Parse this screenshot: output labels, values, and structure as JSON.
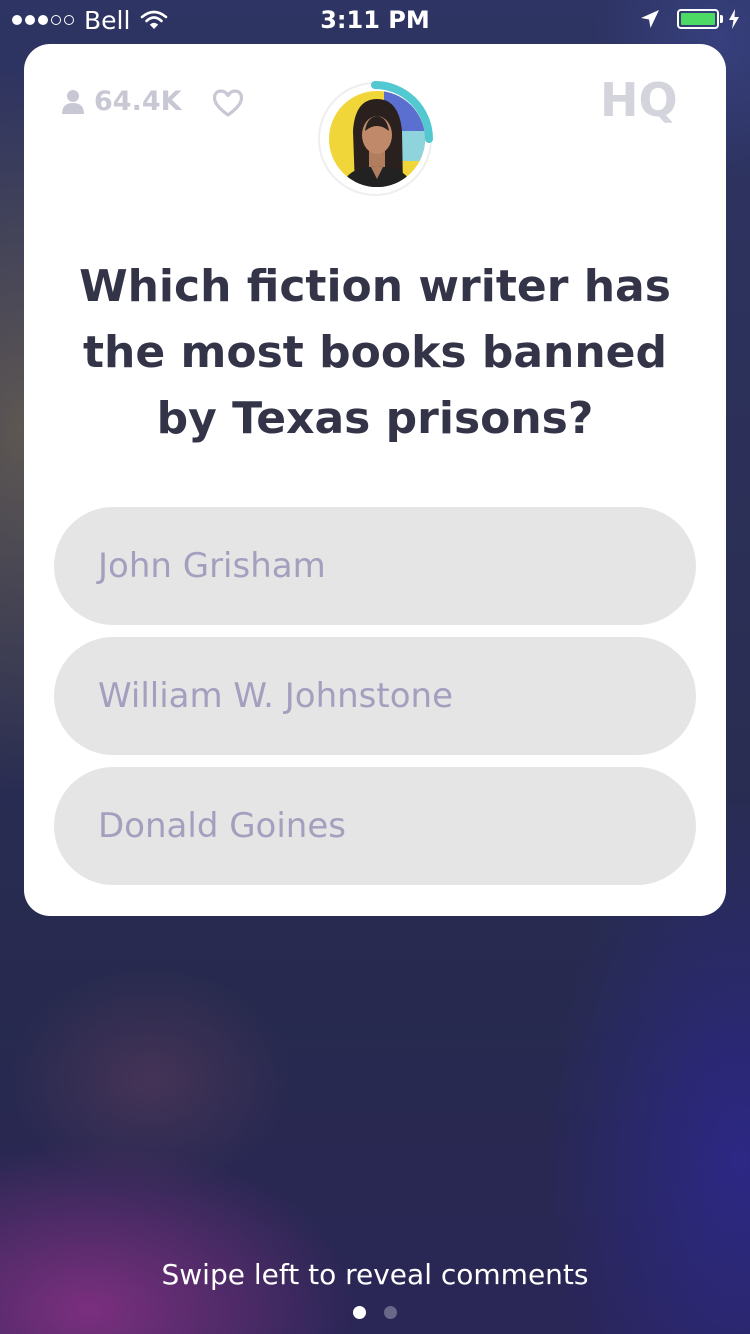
{
  "status_bar": {
    "carrier": "Bell",
    "time": "3:11 PM",
    "signal_bars_filled": 3,
    "signal_bars_total": 5,
    "battery_level": 1.0,
    "battery_color": "#4cd964",
    "icons": [
      "wifi-icon",
      "location-arrow-icon",
      "battery-icon",
      "charging-bolt-icon"
    ]
  },
  "game": {
    "viewer_count": "64.4K",
    "icons": [
      "person-icon",
      "heart-icon",
      "hq-logo"
    ],
    "logo_text": "HQ",
    "question": "Which fiction writer has the most books banned by Texas prisons?",
    "answers": [
      {
        "label": "John Grisham"
      },
      {
        "label": "William W. Johnstone"
      },
      {
        "label": "Donald Goines"
      }
    ],
    "timer_accent_color": "#52c8d0"
  },
  "footer": {
    "swipe_hint": "Swipe left to reveal comments",
    "page_count": 2,
    "active_page": 1
  }
}
